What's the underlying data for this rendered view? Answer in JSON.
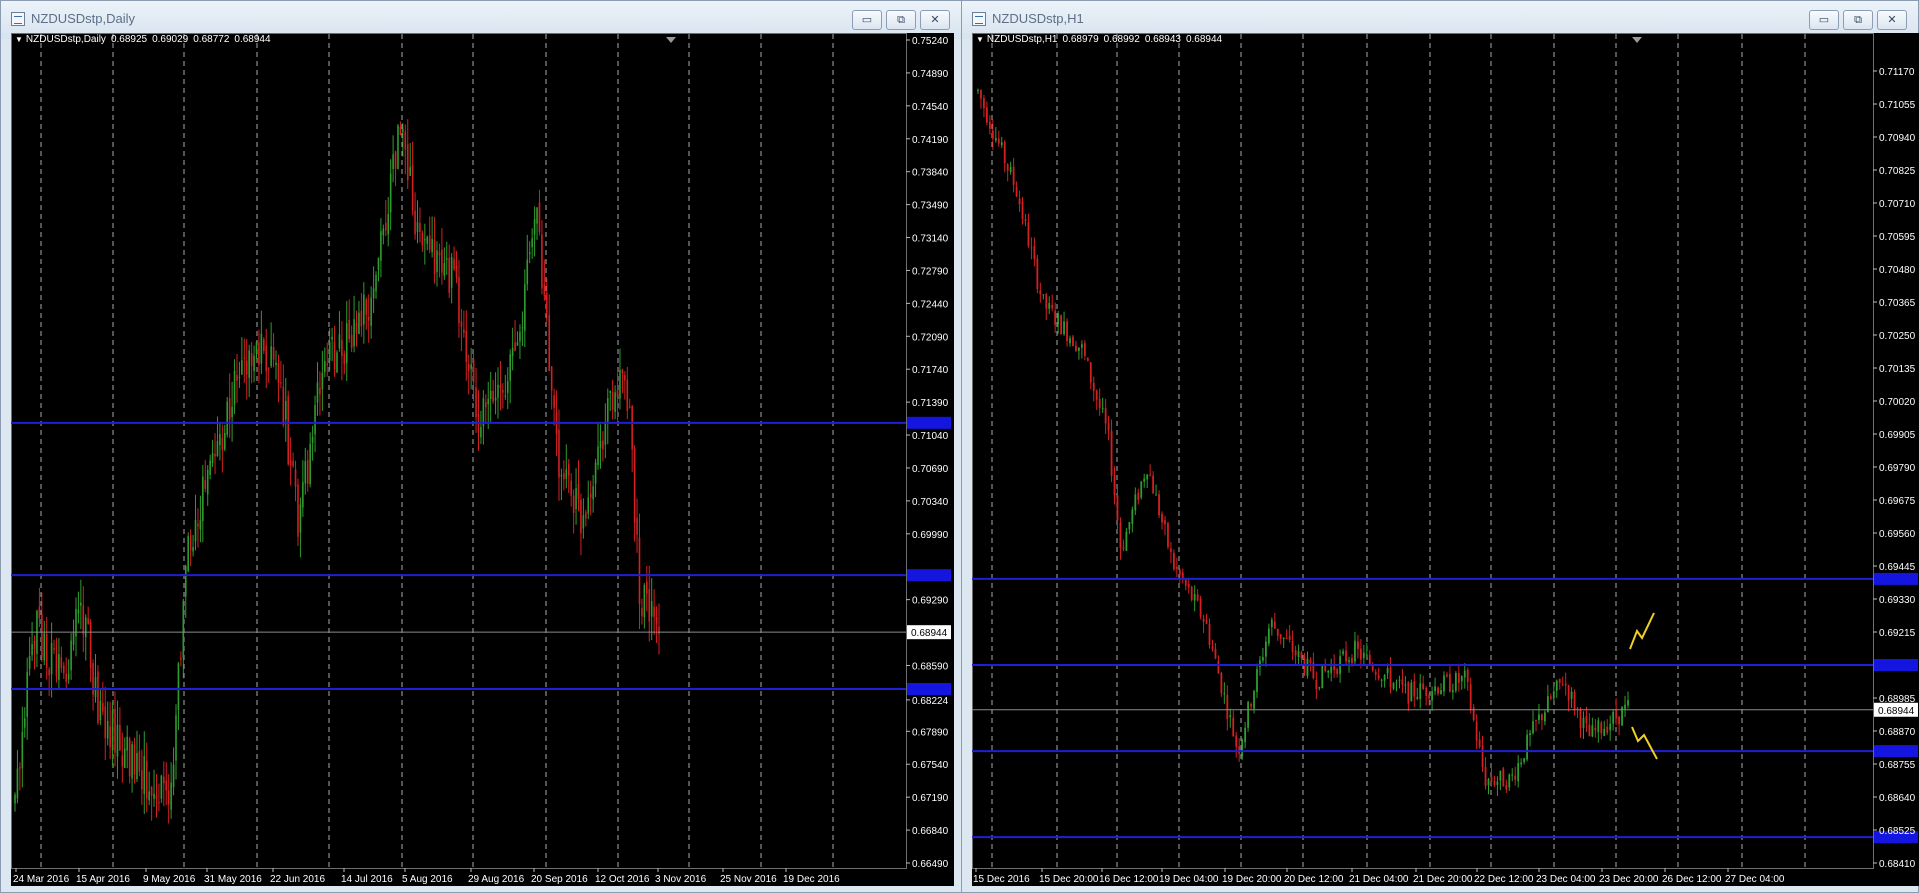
{
  "windows": [
    {
      "title": "NZDUSDstp,Daily",
      "info": {
        "symbol": "NZDUSDstp,Daily",
        "ohlc": [
          "0.68925",
          "0.69029",
          "0.68772",
          "0.68944"
        ]
      },
      "price_labels": [
        "0.75240",
        "0.74890",
        "0.74540",
        "0.74190",
        "0.73840",
        "0.73490",
        "0.73140",
        "0.72790",
        "0.72440",
        "0.72090",
        "0.71740",
        "0.71390",
        "0.71040",
        "0.70690",
        "0.70340",
        "0.69990",
        "0.69290",
        "0.68590",
        "0.68224",
        "0.67890",
        "0.67540",
        "0.67190",
        "0.66840",
        "0.66490"
      ],
      "current_price": "0.68944",
      "date_labels": [
        "24 Mar 2016",
        "15 Apr 2016",
        "9 May 2016",
        "31 May 2016",
        "22 Jun 2016",
        "14 Jul 2016",
        "5 Aug 2016",
        "29 Aug 2016",
        "20 Sep 2016",
        "12 Oct 2016",
        "3 Nov 2016",
        "25 Nov 2016",
        "19 Dec 2016"
      ],
      "horizontal_levels": [
        0.7117,
        0.6955,
        0.6834
      ]
    },
    {
      "title": "NZDUSDstp,H1",
      "info": {
        "symbol": "NZDUSDstp,H1",
        "ohlc": [
          "0.68979",
          "0.68992",
          "0.68943",
          "0.68944"
        ]
      },
      "price_labels": [
        "0.71170",
        "0.71055",
        "0.70940",
        "0.70825",
        "0.70710",
        "0.70595",
        "0.70480",
        "0.70365",
        "0.70250",
        "0.70135",
        "0.70020",
        "0.69905",
        "0.69790",
        "0.69675",
        "0.69560",
        "0.69445",
        "0.69330",
        "0.69215",
        "0.68985",
        "0.68870",
        "0.68755",
        "0.68640",
        "0.68525",
        "0.68410"
      ],
      "current_price": "0.68944",
      "date_labels": [
        "15 Dec 2016",
        "15 Dec 20:00",
        "16 Dec 12:00",
        "19 Dec 04:00",
        "19 Dec 20:00",
        "20 Dec 12:00",
        "21 Dec 04:00",
        "21 Dec 20:00",
        "22 Dec 12:00",
        "23 Dec 04:00",
        "23 Dec 20:00",
        "26 Dec 12:00",
        "27 Dec 04:00"
      ],
      "horizontal_levels": [
        0.694,
        0.691,
        0.688,
        0.685
      ]
    }
  ],
  "window_buttons": {
    "minimize": "▭",
    "restore": "⧉",
    "close": "✕"
  },
  "colors": {
    "background": "#000000",
    "bull_candle": "#2e9e2e",
    "bear_candle": "#d42020",
    "grid": "#c8c8c8",
    "levels": "#1f1fd6",
    "level_label": "#1515e0",
    "current_line": "#8c8c8c",
    "arrow": "#f0d020",
    "axis_text": "#ffffff"
  }
}
